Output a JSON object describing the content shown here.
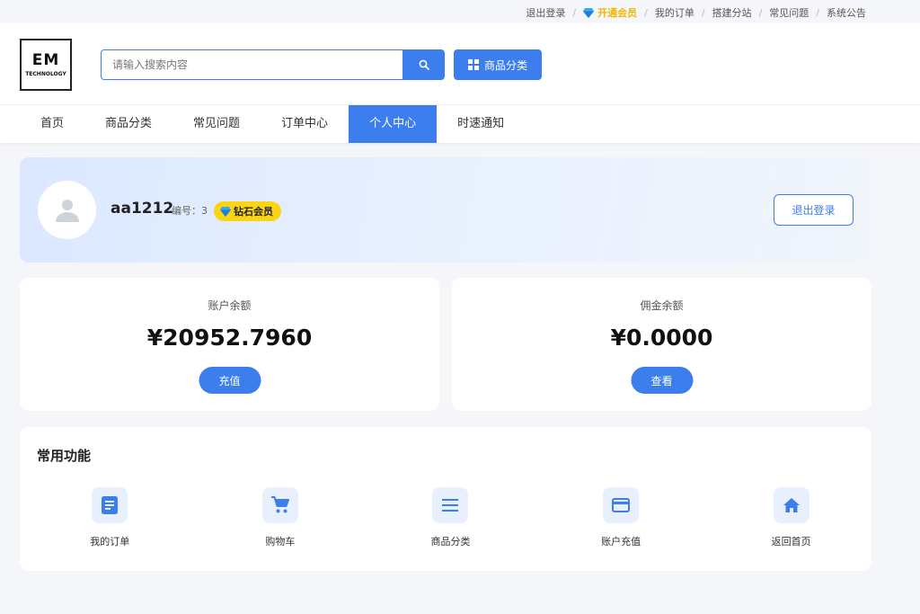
{
  "topbar": {
    "logout": "退出登录",
    "vip": "开通会员",
    "my_orders": "我的订单",
    "build_branch": "搭建分站",
    "faq": "常见问题",
    "announcement": "系统公告"
  },
  "logo": {
    "title": "EM",
    "subtitle": "TECHNOLOGY"
  },
  "search": {
    "placeholder": "请输入搜索内容"
  },
  "category_button": "商品分类",
  "nav": {
    "items": [
      {
        "label": "首页"
      },
      {
        "label": "商品分类"
      },
      {
        "label": "常见问题"
      },
      {
        "label": "订单中心"
      },
      {
        "label": "个人中心"
      },
      {
        "label": "时速通知"
      }
    ],
    "active_index": 4
  },
  "profile": {
    "username": "aa1212",
    "id_text": "编号：3",
    "badge": "钻石会员",
    "logout_button": "退出登录"
  },
  "balance": {
    "label": "账户余额",
    "amount": "¥20952.7960",
    "button": "充值"
  },
  "commission": {
    "label": "佣金余额",
    "amount": "¥0.0000",
    "button": "查看"
  },
  "functions": {
    "title": "常用功能",
    "items": [
      {
        "label": "我的订单",
        "icon": "order-icon"
      },
      {
        "label": "购物车",
        "icon": "cart-icon"
      },
      {
        "label": "商品分类",
        "icon": "list-icon"
      },
      {
        "label": "账户充值",
        "icon": "card-icon"
      },
      {
        "label": "返回首页",
        "icon": "home-icon"
      }
    ]
  },
  "colors": {
    "primary": "#3d7eee",
    "vip": "#f2b705",
    "badge": "#fbd414"
  }
}
